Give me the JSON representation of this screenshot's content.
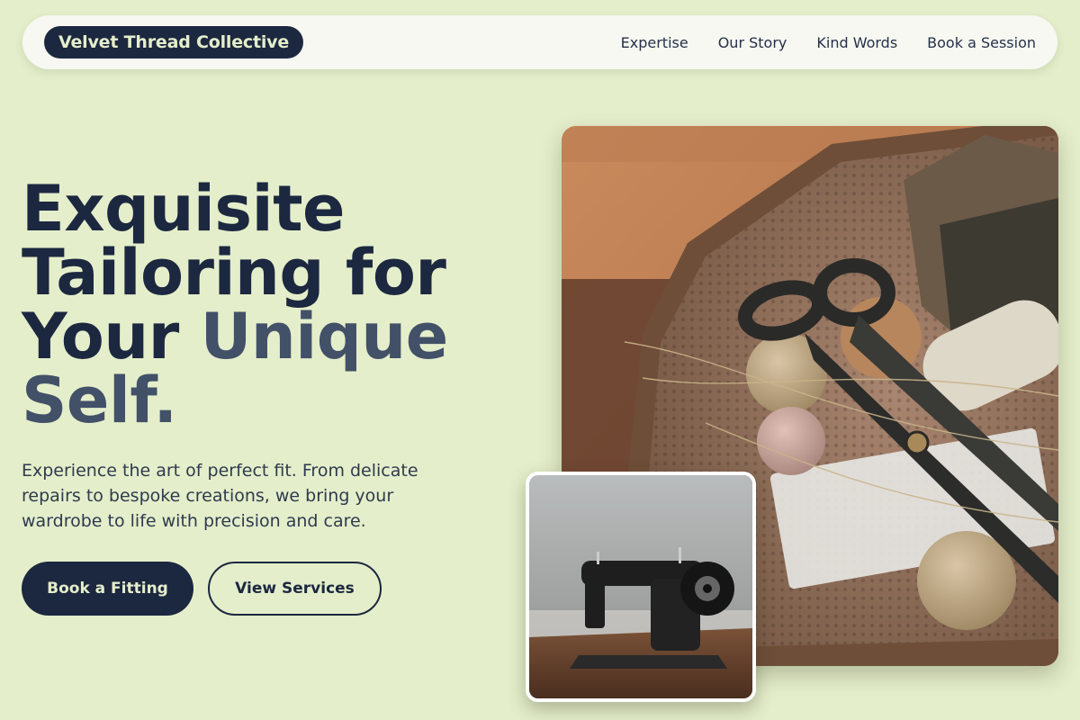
{
  "nav": {
    "brand": "Velvet Thread Collective",
    "links": [
      "Expertise",
      "Our Story",
      "Kind Words",
      "Book a Session"
    ]
  },
  "hero": {
    "headline_line1": "Exquisite",
    "headline_line2": "Tailoring for",
    "headline_line3_a": "Your ",
    "headline_line3_b": "Unique",
    "headline_line4": "Self.",
    "subtext": "Experience the art of perfect fit. From delicate repairs to bespoke creations, we bring your wardrobe to life with precision and care.",
    "primary_button": "Book a Fitting",
    "secondary_button": "View Services"
  },
  "images": {
    "main": "sewing-basket-photo",
    "small": "sewing-machine-photo"
  },
  "colors": {
    "background": "#e4eeca",
    "navy": "#1c2740",
    "accent_text": "#425068"
  }
}
